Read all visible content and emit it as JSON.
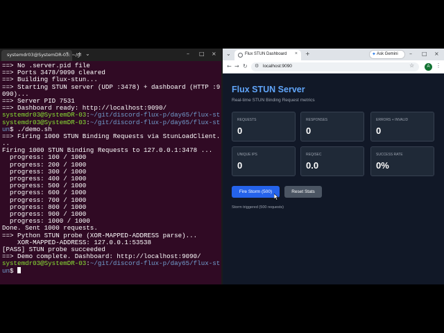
{
  "terminal": {
    "tab_title": "systemdr03@SystemDR-03: ~/gi",
    "tab_close": "×",
    "new_tab": "+",
    "dropdown": "⌄",
    "minimize": "–",
    "maximize": "□",
    "close": "×",
    "lines": [
      {
        "text": "==> No .server.pid file"
      },
      {
        "text": "==> Ports 3478/9090 cleared"
      },
      {
        "text": "==> Building flux-stun..."
      },
      {
        "text": "==> Starting STUN server (UDP :3478) + dashboard (HTTP :9"
      },
      {
        "text": "090)..."
      },
      {
        "text": "==> Server PID 7531"
      },
      {
        "text": "==> Dashboard ready: http://localhost:9090/"
      },
      {
        "userhost": "systemdr03@SystemDR-03",
        "path": "~/git/discord-flux-p/day65/flux-st",
        "text": ""
      },
      {
        "userhost": "systemdr03@SystemDR-03",
        "path": "~/git/discord-flux-p/day65/flux-st",
        "text": ""
      },
      {
        "path": "un",
        "text": "$ ./demo.sh"
      },
      {
        "text": "==> Firing 1000 STUN Binding Requests via StunLoadClient."
      },
      {
        "text": ".."
      },
      {
        "text": "Firing 1000 STUN Binding Requests to 127.0.0.1:3478 ..."
      },
      {
        "text": "  progress: 100 / 1000"
      },
      {
        "text": "  progress: 200 / 1000"
      },
      {
        "text": "  progress: 300 / 1000"
      },
      {
        "text": "  progress: 400 / 1000"
      },
      {
        "text": "  progress: 500 / 1000"
      },
      {
        "text": "  progress: 600 / 1000"
      },
      {
        "text": "  progress: 700 / 1000"
      },
      {
        "text": "  progress: 800 / 1000"
      },
      {
        "text": "  progress: 900 / 1000"
      },
      {
        "text": "  progress: 1000 / 1000"
      },
      {
        "text": "Done. Sent 1000 requests."
      },
      {
        "text": "==> Python STUN probe (XOR-MAPPED-ADDRESS parse)..."
      },
      {
        "text": "    XOR-MAPPED-ADDRESS: 127.0.0.1:53538"
      },
      {
        "text": "[PASS] STUN probe succeeded"
      },
      {
        "text": "==> Demo complete. Dashboard: http://localhost:9090/"
      },
      {
        "userhost": "systemdr03@SystemDR-03",
        "path": "~/git/discord-flux-p/day65/flux-st",
        "text": ""
      },
      {
        "path": "un",
        "text": "$ ",
        "cursor": true
      }
    ]
  },
  "browser": {
    "tab_title": "Flux STUN Dashboard",
    "tab_close": "×",
    "new_tab": "+",
    "ask_gemini": "Ask Gemini",
    "minimize": "–",
    "maximize": "□",
    "close": "×",
    "back": "←",
    "forward": "→",
    "reload": "↻",
    "url": "localhost:9090",
    "avatar_letter": "A",
    "menu": "⋮",
    "star": "☆"
  },
  "dashboard": {
    "title": "Flux STUN Server",
    "subtitle": "Real-time STUN Binding Request metrics",
    "cards": [
      {
        "label": "REQUESTS",
        "value": "0"
      },
      {
        "label": "RESPONSES",
        "value": "0"
      },
      {
        "label": "ERRORS + INVALID",
        "value": "0"
      },
      {
        "label": "UNIQUE IPS",
        "value": "0"
      },
      {
        "label": "REQ/SEC",
        "value": "0.0"
      },
      {
        "label": "SUCCESS RATE",
        "value": "0%"
      }
    ],
    "fire_button": "Fire Storm (500)",
    "reset_button": "Reset Stats",
    "status": "Storm triggered (500 requests)"
  },
  "colors": {
    "terminal_bg": "#300a24",
    "prompt_user": "#8ae234",
    "prompt_path": "#729fcf",
    "dashboard_bg": "#111827",
    "accent": "#60a5fa",
    "primary_button": "#2563eb"
  }
}
